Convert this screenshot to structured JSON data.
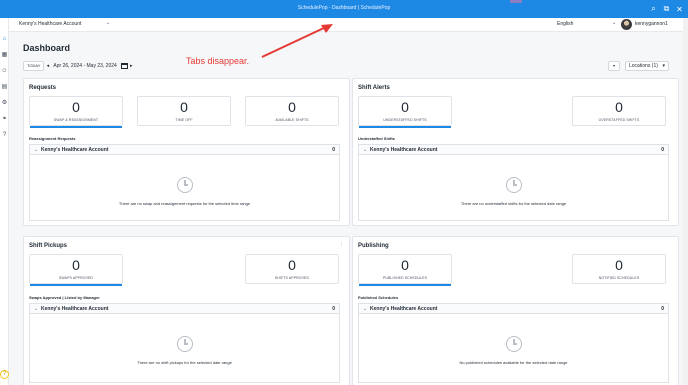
{
  "window": {
    "title": "SchedulePop - Dashboard | SchedulePop"
  },
  "topbar": {
    "account": "Kenny's Healthcare Account",
    "language": "English",
    "username": "kennygannon1"
  },
  "page": {
    "title": "Dashboard"
  },
  "toolbar": {
    "today": "TODAY",
    "prev": "◂",
    "range": "Apr 26, 2024 - May 23, 2024",
    "next": "▸",
    "locations": "Locations (1)"
  },
  "annotation": {
    "text": "Tabs disappear."
  },
  "panels": {
    "requests": {
      "title": "Requests",
      "stats": [
        {
          "value": "0",
          "label": "SWAP & REASSIGNMENT"
        },
        {
          "value": "0",
          "label": "TIME OFF"
        },
        {
          "value": "0",
          "label": "AVAILABLE SHIFTS"
        }
      ],
      "subheading": "Reassignment Requests",
      "group": {
        "name": "Kenny's Healthcare Account",
        "count": "0"
      },
      "empty": "There are no swap and reassignment requests for the selected time range"
    },
    "shift_alerts": {
      "title": "Shift Alerts",
      "stats": [
        {
          "value": "0",
          "label": "UNDERSTAFFED SHIFTS"
        },
        {
          "value": "0",
          "label": "OVERSTAFFED SHIFTS"
        }
      ],
      "subheading": "Understaffed Shifts",
      "group": {
        "name": "Kenny's Healthcare Account",
        "count": "0"
      },
      "empty": "There are no understaffed shifts for the selected date range"
    },
    "shift_pickups": {
      "title": "Shift Pickups",
      "stats": [
        {
          "value": "0",
          "label": "SWAPS APPROVED"
        },
        {
          "value": "0",
          "label": "SHIFTS APPROVED"
        }
      ],
      "subheading": "Swaps Approved | Listed by Manager",
      "group": {
        "name": "Kenny's Healthcare Account",
        "count": "0"
      },
      "empty": "There are no shift pickups for the selected date range"
    },
    "publishing": {
      "title": "Publishing",
      "stats": [
        {
          "value": "0",
          "label": "PUBLISHED SCHEDULES"
        },
        {
          "value": "0",
          "label": "NOTIFIED SCHEDULES"
        }
      ],
      "subheading": "Published Schedules",
      "group": {
        "name": "Kenny's Healthcare Account",
        "count": "0"
      },
      "empty": "No published schedules available for the selected date range"
    }
  },
  "colors": {
    "accent": "#1e88e5",
    "annotation": "#e53935"
  },
  "icons": [
    "home-icon",
    "calendar-icon",
    "users-icon",
    "report-icon",
    "settings-icon",
    "link-icon",
    "help-icon",
    "clock-icon",
    "search-icon",
    "extension-icon",
    "close-icon",
    "download-icon"
  ]
}
